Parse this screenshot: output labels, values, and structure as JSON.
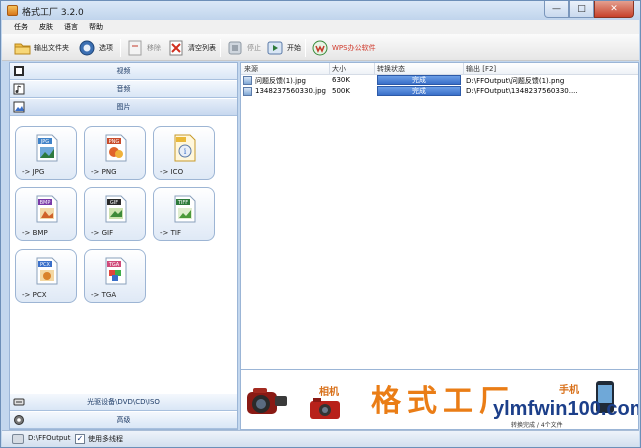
{
  "window": {
    "title": "格式工厂 3.2.0",
    "min_glyph": "—",
    "max_glyph": "□",
    "close_glyph": "✕"
  },
  "menu": [
    "任务",
    "皮肤",
    "语言",
    "帮助"
  ],
  "toolbar": {
    "output_folder": "输出文件夹",
    "options": "选项",
    "remove": "移除",
    "clear_list": "清空列表",
    "stop": "停止",
    "start": "开始",
    "wps": "WPS办公软件"
  },
  "categories": {
    "video": "视频",
    "audio": "音频",
    "image": "图片",
    "optical": "光驱设备\\DVD\\CD\\ISO",
    "advanced": "高级"
  },
  "tiles": [
    {
      "label": "-> JPG",
      "badge": "JPG",
      "color": "#3f82c8"
    },
    {
      "label": "-> PNG",
      "badge": "PNG",
      "color": "#c94b2a"
    },
    {
      "label": "-> ICO",
      "badge": "",
      "color": "#e9b838"
    },
    {
      "label": "-> BMP",
      "badge": "BMP",
      "color": "#7a3aa8"
    },
    {
      "label": "-> GIF",
      "badge": "GIF",
      "color": "#2a2a2a"
    },
    {
      "label": "-> TIF",
      "badge": "TIFF",
      "color": "#2d7a3a"
    },
    {
      "label": "-> PCX",
      "badge": "PCX",
      "color": "#3a6fc9"
    },
    {
      "label": "-> TGA",
      "badge": "TGA",
      "color": "#d04a7a"
    }
  ],
  "list": {
    "headers": {
      "source": "来源",
      "size": "大小",
      "status": "转换状态",
      "output": "输出 [F2]"
    },
    "rows": [
      {
        "name": "问题反馈(1).jpg",
        "size": "630K",
        "status": "完成",
        "output": "D:\\FFOutput\\问题反馈(1).png"
      },
      {
        "name": "1348237560330.jpg",
        "size": "500K",
        "status": "完成",
        "output": "D:\\FFOutput\\1348237560330...."
      }
    ]
  },
  "banner": {
    "camera": "相机",
    "title": "格式工厂",
    "phone": "手机",
    "watermark": "ylmfwin100.com",
    "watermark_sub": "转换完成 / 4个文件"
  },
  "statusbar": {
    "path": "D:\\FFOutput",
    "multithread_label": "使用多线程",
    "multithread_checked": "✓"
  },
  "colors": {
    "accent": "#3a6fc9",
    "orange": "#ea7d16",
    "panel_border": "#9bb5d6"
  }
}
